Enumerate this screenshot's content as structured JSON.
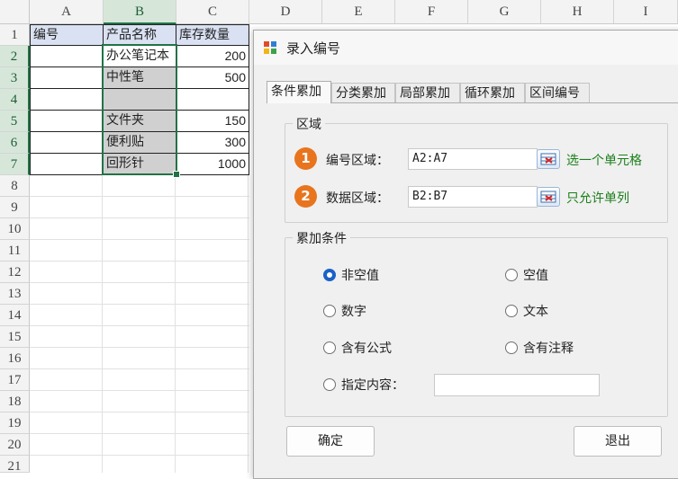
{
  "spreadsheet": {
    "columns": [
      "A",
      "B",
      "C",
      "D",
      "E",
      "F",
      "G",
      "H",
      "I"
    ],
    "rows": [
      "1",
      "2",
      "3",
      "4",
      "5",
      "6",
      "7",
      "8",
      "9",
      "10",
      "11",
      "12",
      "13",
      "14",
      "15",
      "16",
      "17",
      "18",
      "19",
      "20",
      "21"
    ],
    "cells": {
      "A1": "编号",
      "B1": "产品名称",
      "C1": "库存数量",
      "B2": "办公笔记本",
      "C2": "200",
      "B3": "中性笔",
      "C3": "500",
      "B5": "文件夹",
      "C5": "150",
      "B6": "便利贴",
      "C6": "300",
      "B7": "回形针",
      "C7": "1000"
    }
  },
  "dialog": {
    "title": "录入编号",
    "tabs": [
      "条件累加",
      "分类累加",
      "局部累加",
      "循环累加",
      "区间编号"
    ],
    "active_tab": "条件累加",
    "region_group": {
      "label": "区域",
      "fields": [
        {
          "badge": "1",
          "label": "编号区域：",
          "value": "A2:A7",
          "hint": "选一个单元格"
        },
        {
          "badge": "2",
          "label": "数据区域：",
          "value": "B2:B7",
          "hint": "只允许单列"
        }
      ]
    },
    "condition_group": {
      "label": "累加条件",
      "options": [
        {
          "label": "非空值",
          "checked": true
        },
        {
          "label": "空值",
          "checked": false
        },
        {
          "label": "数字",
          "checked": false
        },
        {
          "label": "文本",
          "checked": false
        },
        {
          "label": "含有公式",
          "checked": false
        },
        {
          "label": "含有注释",
          "checked": false
        },
        {
          "label": "指定内容：",
          "checked": false
        }
      ],
      "specified_content_value": ""
    },
    "ok_label": "确定",
    "exit_label": "退出"
  },
  "colors": {
    "accent_green": "#217346",
    "badge_orange": "#e8741e",
    "hint_green": "#1a7f1a",
    "header_fill": "#d9e1f2",
    "gray_fill": "#d0d0d0",
    "radio_blue": "#1a61c8"
  }
}
